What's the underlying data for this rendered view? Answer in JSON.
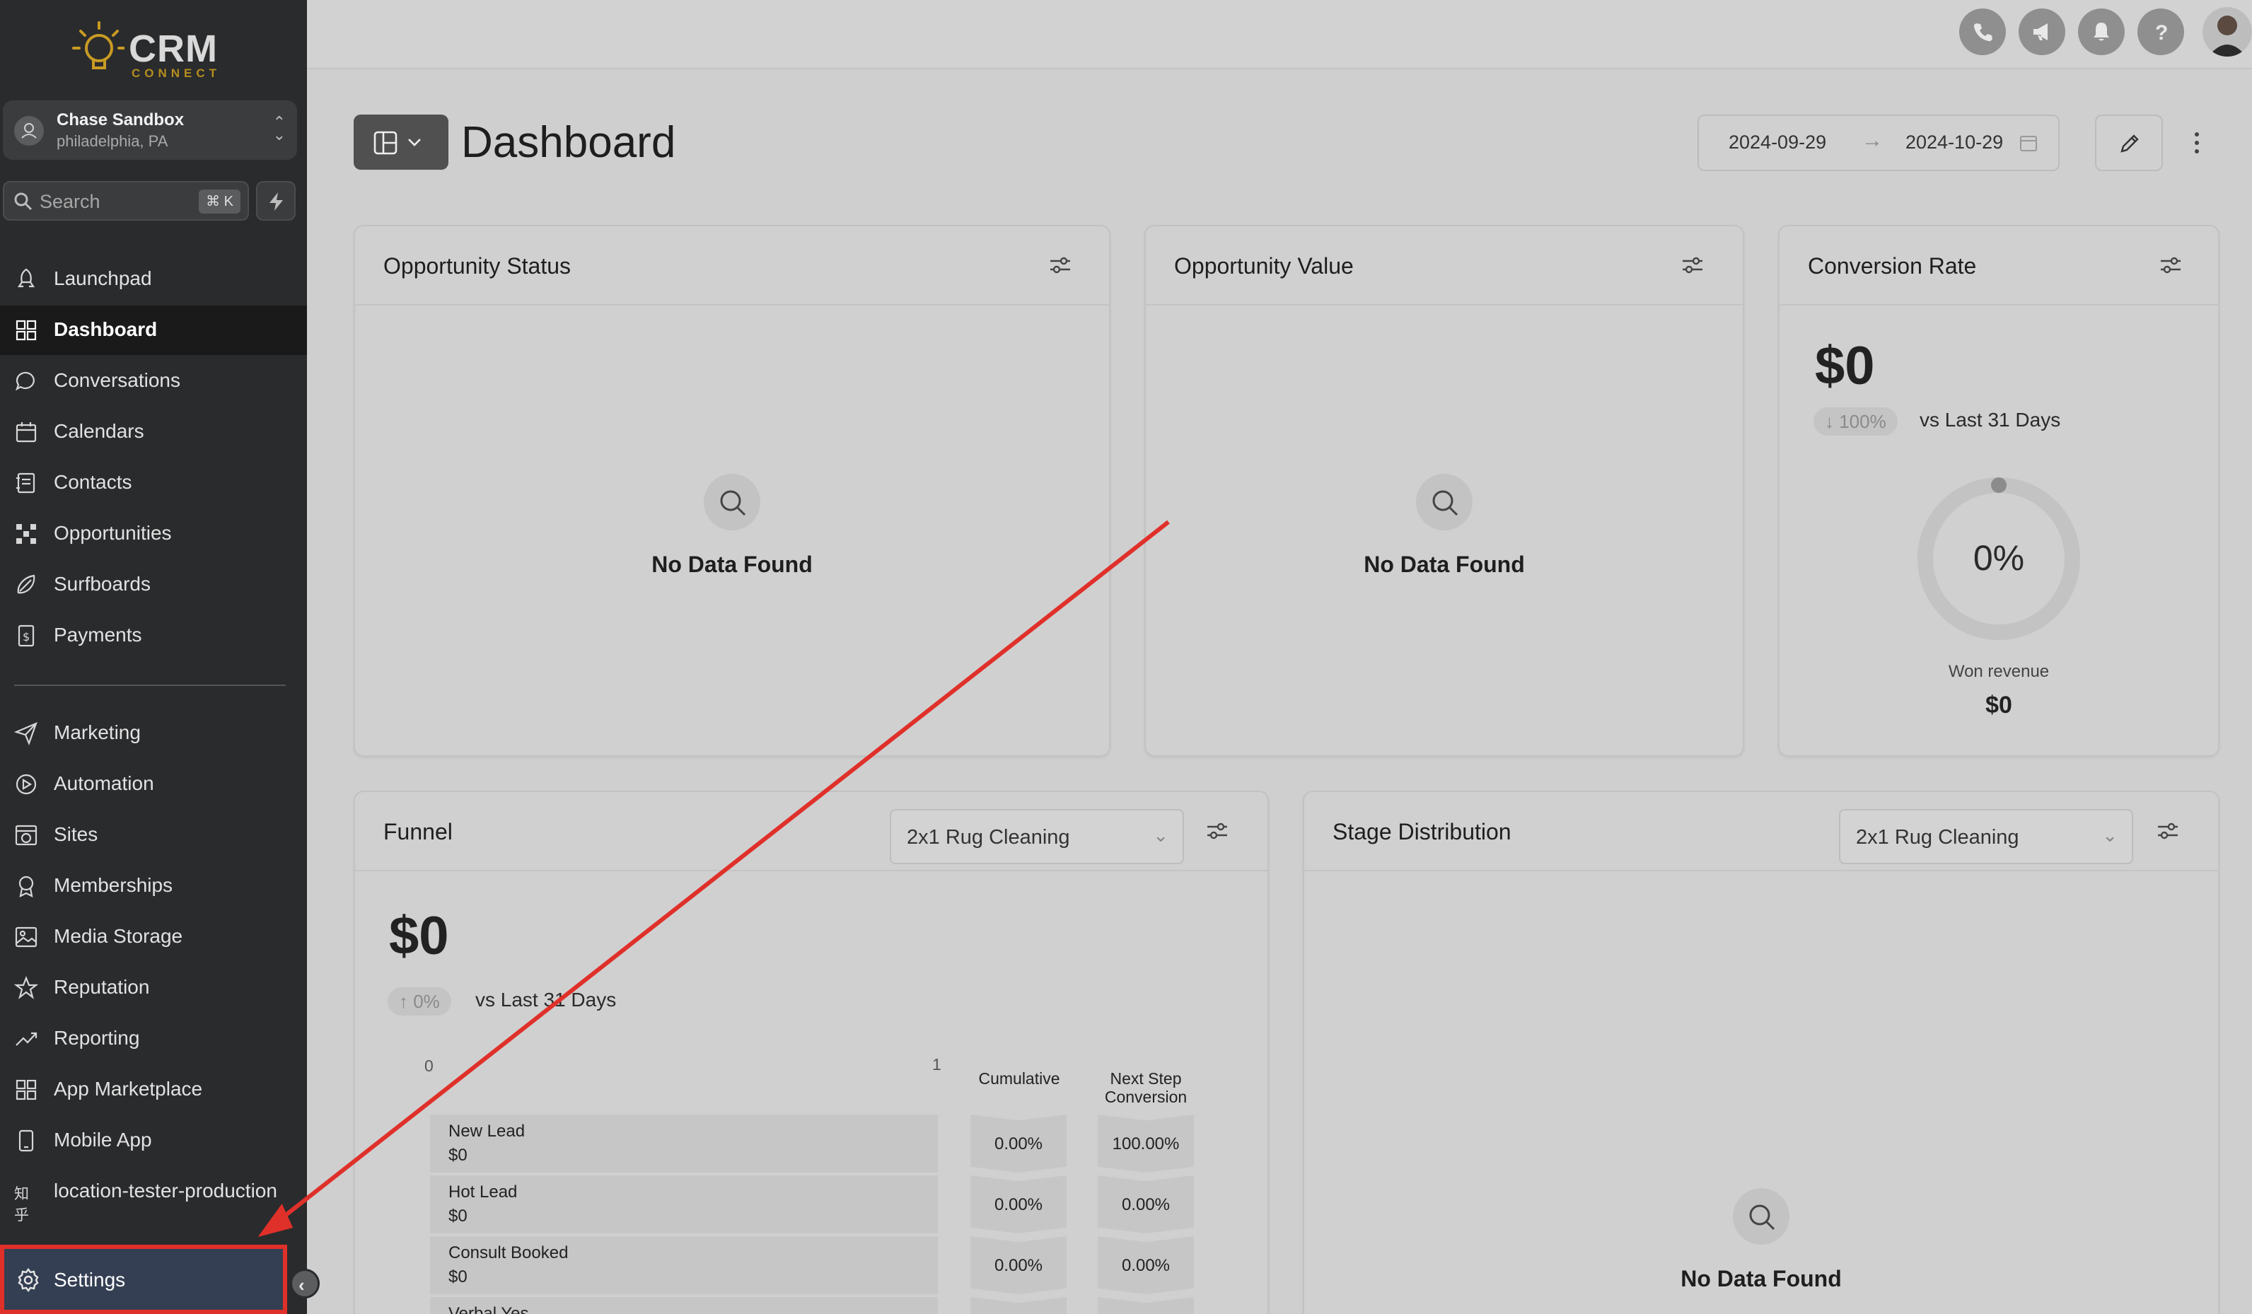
{
  "app": {
    "logo_text": "CRM",
    "logo_sub": "CONNECT"
  },
  "account": {
    "name": "Chase Sandbox",
    "location": "philadelphia, PA"
  },
  "search": {
    "placeholder": "Search",
    "shortcut": "⌘ K"
  },
  "nav": {
    "primary": [
      {
        "label": "Launchpad",
        "icon": "rocket-icon"
      },
      {
        "label": "Dashboard",
        "icon": "grid-icon",
        "active": true
      },
      {
        "label": "Conversations",
        "icon": "chat-icon"
      },
      {
        "label": "Calendars",
        "icon": "calendar-icon"
      },
      {
        "label": "Contacts",
        "icon": "contacts-icon"
      },
      {
        "label": "Opportunities",
        "icon": "network-icon"
      },
      {
        "label": "Surfboards",
        "icon": "surfboard-icon"
      },
      {
        "label": "Payments",
        "icon": "receipt-icon"
      }
    ],
    "secondary": [
      {
        "label": "Marketing",
        "icon": "send-icon"
      },
      {
        "label": "Automation",
        "icon": "automation-icon"
      },
      {
        "label": "Sites",
        "icon": "globe-icon"
      },
      {
        "label": "Memberships",
        "icon": "badge-icon"
      },
      {
        "label": "Media Storage",
        "icon": "image-icon"
      },
      {
        "label": "Reputation",
        "icon": "star-icon"
      },
      {
        "label": "Reporting",
        "icon": "trend-icon"
      },
      {
        "label": "App Marketplace",
        "icon": "apps-icon"
      },
      {
        "label": "Mobile App",
        "icon": "phone-device-icon"
      },
      {
        "label": "location-tester-production",
        "icon": "知乎"
      }
    ],
    "settings_label": "Settings"
  },
  "header": {
    "title": "Dashboard",
    "date_start": "2024-09-29",
    "date_end": "2024-10-29"
  },
  "cards": {
    "opportunity_status": {
      "title": "Opportunity Status",
      "empty": "No Data Found"
    },
    "opportunity_value": {
      "title": "Opportunity Value",
      "empty": "No Data Found"
    },
    "conversion_rate": {
      "title": "Conversion Rate",
      "value": "$0",
      "delta": "↓ 100%",
      "vs": "vs Last 31 Days",
      "gauge_value": "0%",
      "won_label": "Won revenue",
      "won_value": "$0"
    },
    "funnel": {
      "title": "Funnel",
      "pipeline": "2x1 Rug Cleaning",
      "value": "$0",
      "delta": "↑ 0%",
      "vs": "vs Last 31 Days",
      "axis_min": "0",
      "axis_max": "1",
      "col_cumulative": "Cumulative",
      "col_next_step": "Next Step Conversion",
      "rows": [
        {
          "name": "New Lead",
          "value": "$0",
          "cumulative": "0.00%",
          "next": "100.00%"
        },
        {
          "name": "Hot Lead",
          "value": "$0",
          "cumulative": "0.00%",
          "next": "0.00%"
        },
        {
          "name": "Consult Booked",
          "value": "$0",
          "cumulative": "0.00%",
          "next": "0.00%"
        },
        {
          "name": "Verbal Yes",
          "value": "",
          "cumulative": "",
          "next": ""
        }
      ]
    },
    "stage_distribution": {
      "title": "Stage Distribution",
      "pipeline": "2x1 Rug Cleaning",
      "empty": "No Data Found"
    }
  },
  "colors": {
    "sidebar_bg": "#2a2b2d",
    "active_bg": "#1a1a1b",
    "highlight_border": "#e0302a",
    "annotation_arrow": "#e0302a",
    "content_bg": "#cfcfcf"
  }
}
